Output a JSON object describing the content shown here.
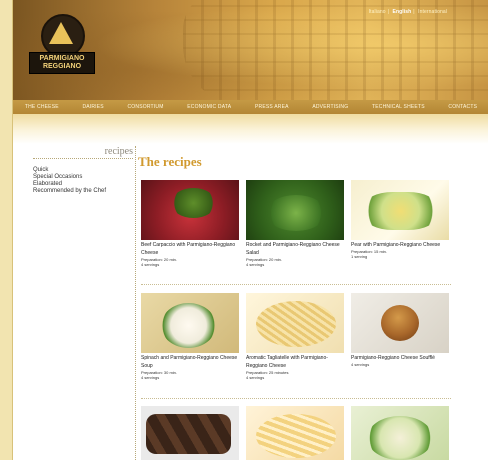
{
  "header": {
    "languages": [
      "Italiano",
      "English",
      "International"
    ],
    "active_language_index": 1,
    "logo_line1": "PARMIGIANO",
    "logo_line2": "REGGIANO"
  },
  "nav": [
    "THE CHEESE",
    "DAIRIES",
    "CONSORTIUM",
    "ECONOMIC DATA",
    "PRESS AREA",
    "ADVERTISING",
    "TECHNICAL SHEETS",
    "CONTACTS"
  ],
  "sidebar": {
    "title": "recipes",
    "items": [
      "Quick",
      "Special Occasions",
      "Elaborated",
      "Recommended by the Chef"
    ]
  },
  "main": {
    "title": "The recipes",
    "recipes": [
      {
        "name": "Beef Carpaccio with Parmigiano-Reggiano Cheese",
        "prep": "Preparation: 20 min.",
        "servings": "4 servings"
      },
      {
        "name": "Rocket and Parmigiano-Reggiano Cheese Salad",
        "prep": "Preparation: 20 min.",
        "servings": "4 servings"
      },
      {
        "name": "Pear with Parmigiano-Reggiano Cheese",
        "prep": "Preparation: 15 min.",
        "servings": "1 serving"
      },
      {
        "name": "Spinach and Parmigiano-Reggiano Cheese Soup",
        "prep": "Preparation: 30 min.",
        "servings": "4 servings"
      },
      {
        "name": "Aromatic Tagliatelle with Parmigiano-Reggiano Cheese",
        "prep": "Preparation: 25 minutes",
        "servings": "4 servings"
      },
      {
        "name": "Parmigiano-Reggiano Cheese Soufflé",
        "prep": "",
        "servings": "4 servings"
      },
      {
        "name": "",
        "prep": "",
        "servings": ""
      },
      {
        "name": "",
        "prep": "",
        "servings": ""
      },
      {
        "name": "",
        "prep": "",
        "servings": ""
      }
    ]
  }
}
